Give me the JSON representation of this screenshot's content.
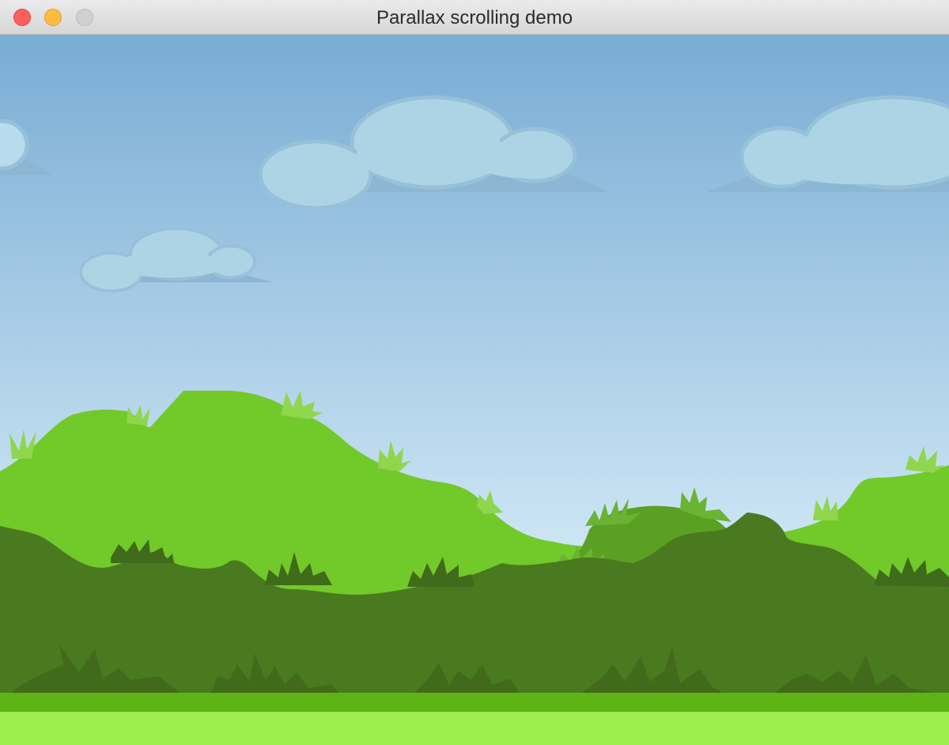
{
  "window": {
    "title": "Parallax scrolling demo",
    "buttons": [
      {
        "name": "close",
        "color": "#fc605c"
      },
      {
        "name": "minimize",
        "color": "#fdbc40"
      },
      {
        "name": "zoom",
        "color": "#d0d0d0"
      }
    ]
  },
  "scene": {
    "sky_top_color": "#79acd4",
    "sky_bottom_color": "#d6ecf8",
    "cloud_color": "#acd4e4",
    "cloud_shadow_color": "#8db6d4",
    "back_hills_color": "#72c92a",
    "mid_hills_color": "#5aa023",
    "front_hills_color": "#4a7a1f",
    "grass_strip_color": "#5fb415",
    "ground_color": "#9ced4e"
  }
}
